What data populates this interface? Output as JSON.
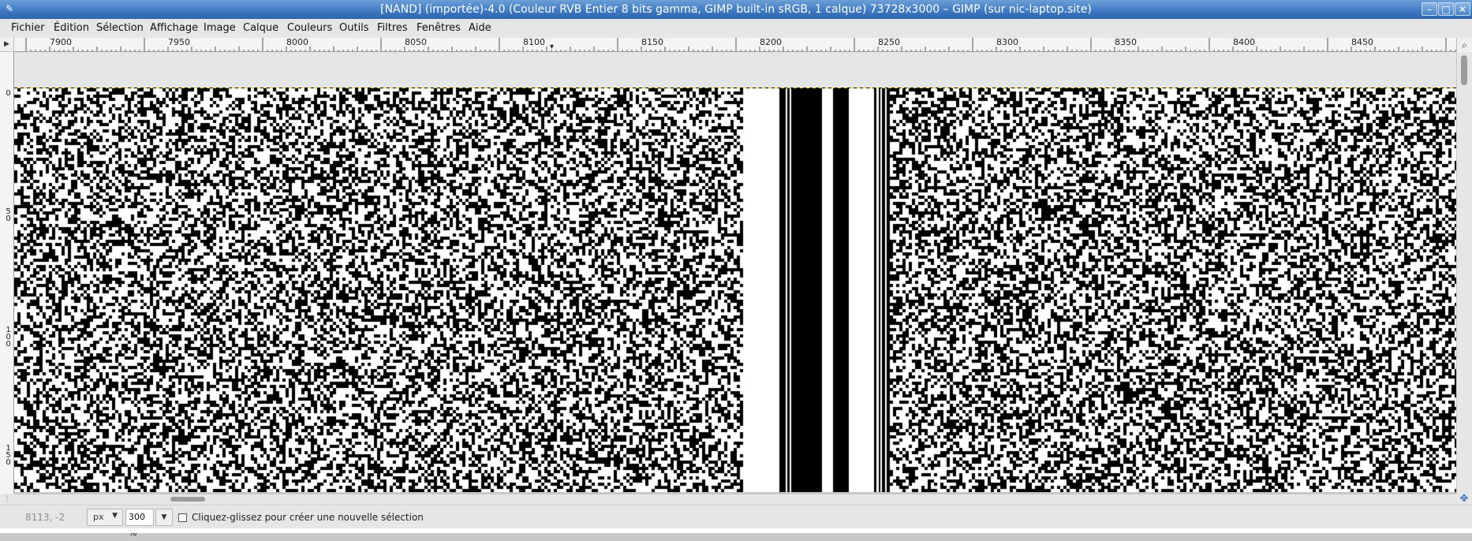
{
  "window": {
    "title": "[NAND] (importée)-4.0 (Couleur RVB Entier 8 bits gamma, GIMP built-in sRGB, 1 calque) 73728x3000 – GIMP (sur nic-laptop.site)",
    "app_icon": "gimp-icon",
    "controls": {
      "minimize": "–",
      "maximize": "□",
      "close": "✕"
    }
  },
  "menu": {
    "items": [
      "Fichier",
      "Édition",
      "Sélection",
      "Affichage",
      "Image",
      "Calque",
      "Couleurs",
      "Outils",
      "Filtres",
      "Fenêtres",
      "Aide"
    ]
  },
  "rulers": {
    "horizontal_labels": [
      "7900",
      "7950",
      "8000",
      "8050",
      "8100",
      "8150",
      "8200",
      "8250",
      "8300",
      "8350",
      "8400",
      "8450"
    ],
    "vertical_labels": [
      "0",
      "50",
      "100",
      "150"
    ],
    "pointer_marker": "▾"
  },
  "canvas": {
    "content": "black and white pixel noise pattern with vertical stripe band",
    "colors": {
      "ink": "#000000",
      "paper": "#ffffff",
      "padding": "#e6e6e6"
    }
  },
  "statusbar": {
    "coords": "8113, -2",
    "unit": "px",
    "zoom": "300 %",
    "message": "Cliquez-glissez pour créer une nouvelle sélection"
  },
  "icons": {
    "ruler_corner": "quick-mask-icon",
    "zoom_corner": "zoom-icon",
    "navigate": "navigate-icon"
  }
}
